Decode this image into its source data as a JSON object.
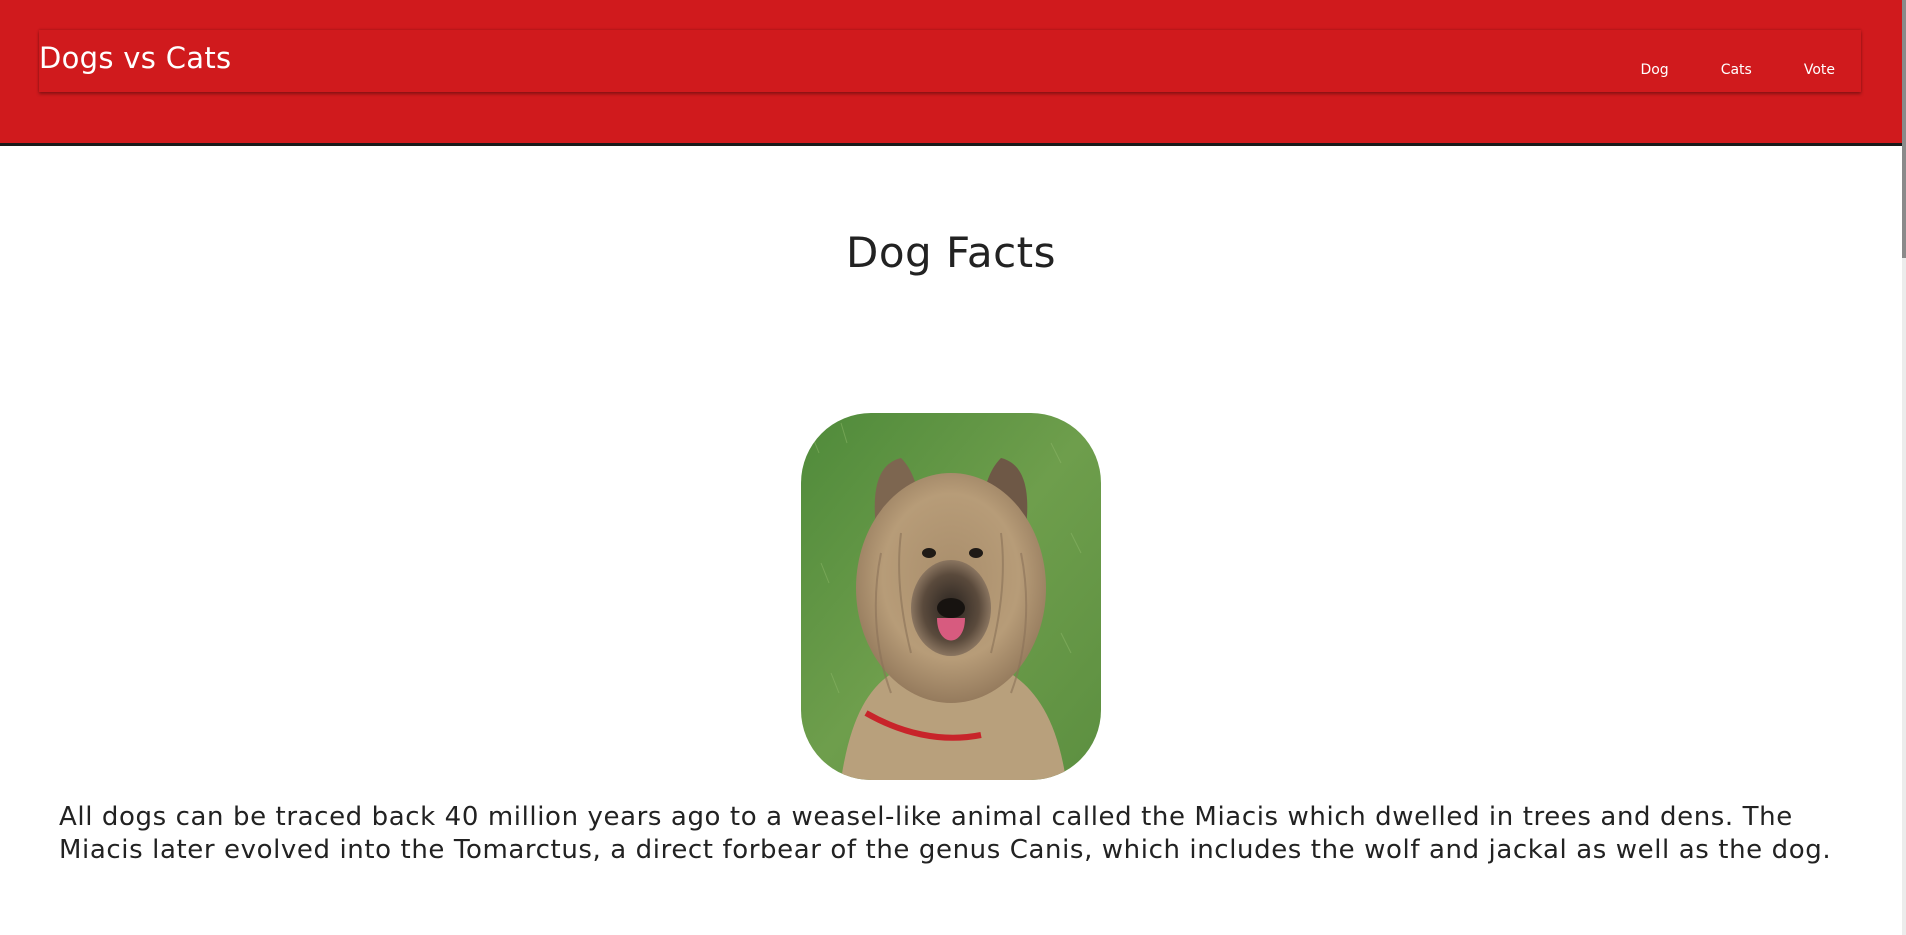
{
  "header": {
    "brand": "Dogs vs Cats",
    "nav": [
      "Dog",
      "Cats",
      "Vote"
    ],
    "background_color": "#d01a1d"
  },
  "main": {
    "title": "Dog Facts",
    "photo": {
      "description": "dog photo",
      "icon": "dog-photo"
    },
    "fact": "All dogs can be traced back 40 million years ago to a weasel-like animal called the Miacis which dwelled in trees and dens. The Miacis later evolved into the Tomarctus, a direct forbear of the genus Canis, which includes the wolf and jackal as well as the dog."
  }
}
